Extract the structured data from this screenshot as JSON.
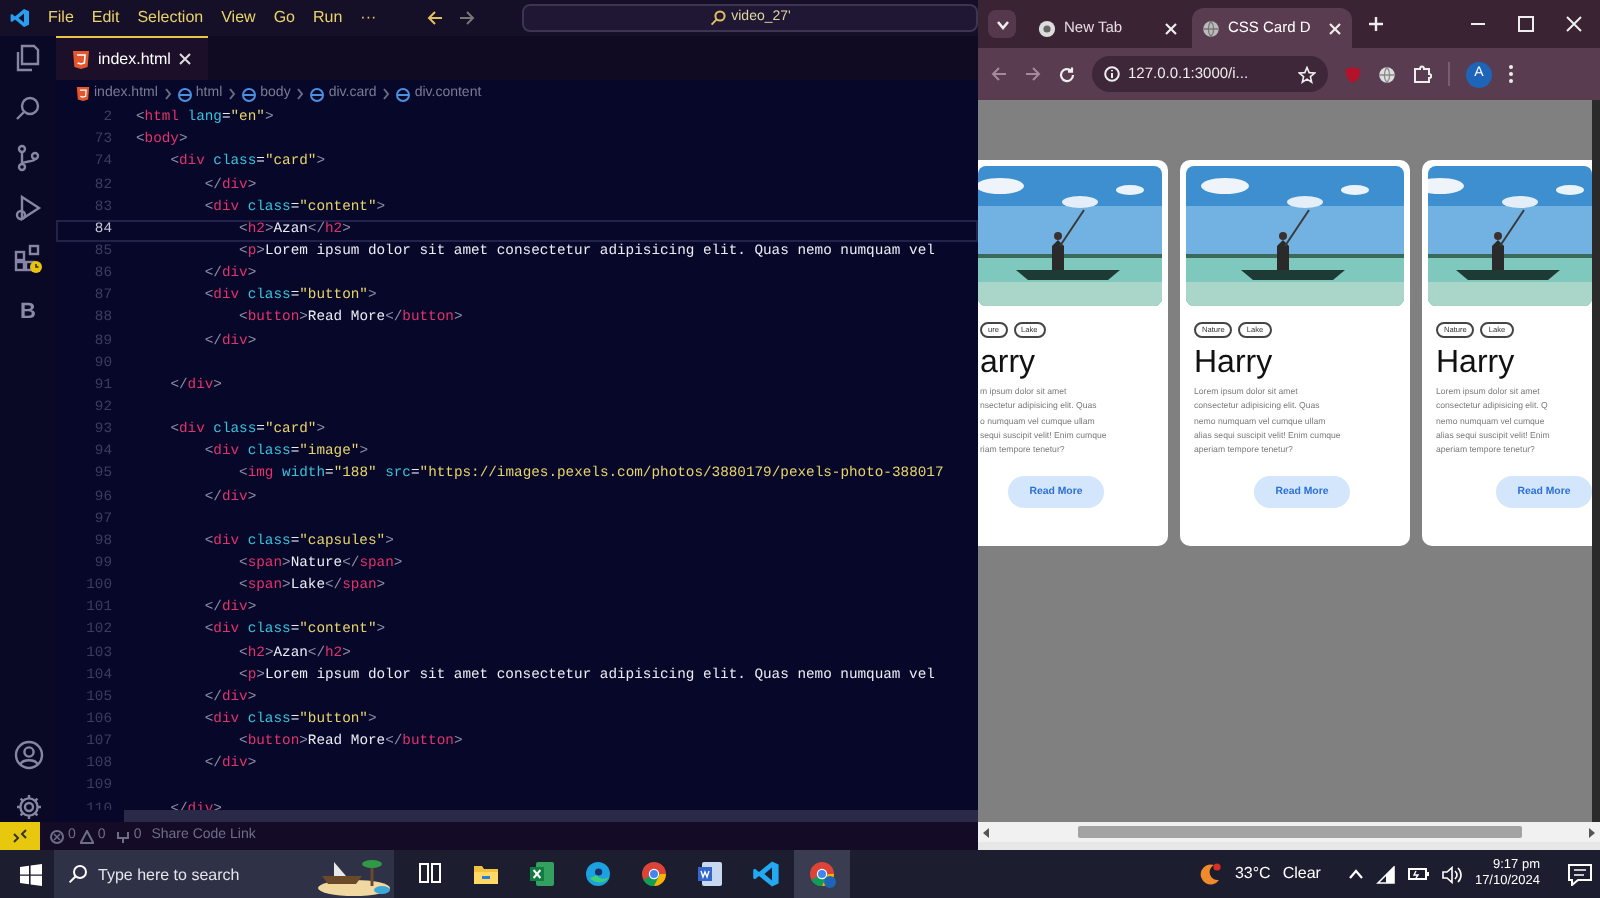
{
  "editor": {
    "menu": [
      "File",
      "Edit",
      "Selection",
      "View",
      "Go",
      "Run",
      "···"
    ],
    "command_center": "video_27'",
    "tab": {
      "label": "index.html"
    },
    "breadcrumb": [
      "index.html",
      "html",
      "body",
      "div.card",
      "div.content"
    ],
    "code_lines": [
      {
        "number": "2",
        "text": "<html lang=\"en\">",
        "current": false
      },
      {
        "number": "73",
        "text": "<body>",
        "current": false
      },
      {
        "number": "74",
        "text": "    <div class=\"card\">",
        "current": false
      },
      {
        "number": "82",
        "text": "        </div>",
        "current": false
      },
      {
        "number": "83",
        "text": "        <div class=\"content\">",
        "current": false
      },
      {
        "number": "84",
        "text": "            <h2>Azan</h2>",
        "current": true
      },
      {
        "number": "85",
        "text": "            <p>Lorem ipsum dolor sit amet consectetur adipisicing elit. Quas nemo numquam vel",
        "current": false
      },
      {
        "number": "86",
        "text": "        </div>",
        "current": false
      },
      {
        "number": "87",
        "text": "        <div class=\"button\">",
        "current": false
      },
      {
        "number": "88",
        "text": "            <button>Read More</button>",
        "current": false
      },
      {
        "number": "89",
        "text": "        </div>",
        "current": false
      },
      {
        "number": "90",
        "current": false
      },
      {
        "number": "91",
        "text": "    </div>",
        "current": false
      },
      {
        "number": "92",
        "current": false
      },
      {
        "number": "93",
        "text": "    <div class=\"card\">",
        "current": false
      },
      {
        "number": "94",
        "text": "        <div class=\"image\">",
        "current": false
      },
      {
        "number": "95",
        "text": "            <img width=\"188\" src=\"https://images.pexels.com/photos/3880179/pexels-photo-388017",
        "current": false
      },
      {
        "number": "96",
        "text": "        </div>",
        "current": false
      },
      {
        "number": "97",
        "current": false
      },
      {
        "number": "98",
        "text": "        <div class=\"capsules\">",
        "current": false
      },
      {
        "number": "99",
        "text": "            <span>Nature</span>",
        "current": false
      },
      {
        "number": "100",
        "text": "            <span>Lake</span>",
        "current": false
      },
      {
        "number": "101",
        "text": "        </div>",
        "current": false
      },
      {
        "number": "102",
        "text": "        <div class=\"content\">",
        "current": false
      },
      {
        "number": "103",
        "text": "            <h2>Azan</h2>",
        "current": false
      },
      {
        "number": "104",
        "text": "            <p>Lorem ipsum dolor sit amet consectetur adipisicing elit. Quas nemo numquam vel",
        "current": false
      },
      {
        "number": "105",
        "text": "        </div>",
        "current": false
      },
      {
        "number": "106",
        "text": "        <div class=\"button\">",
        "current": false
      },
      {
        "number": "107",
        "text": "            <button>Read More</button>",
        "current": false
      },
      {
        "number": "108",
        "text": "        </div>",
        "current": false
      },
      {
        "number": "109",
        "current": false
      },
      {
        "number": "110",
        "text": "    </div>",
        "current": false
      }
    ],
    "activity_letter": "B",
    "status_bar": {
      "errors": "0",
      "warnings": "0",
      "ports": "0",
      "share": "Share Code Link"
    }
  },
  "browser": {
    "tabs": [
      {
        "label": "New Tab",
        "selected": false
      },
      {
        "label": "CSS Card D",
        "selected": true
      }
    ],
    "address": "127.0.0.1:3000/i...",
    "profile": "A",
    "cards": [
      {
        "image": {
          "kind": "picture"
        },
        "tags": [
          "ure",
          "Lake"
        ],
        "title": "arry",
        "text": "m ipsum dolor sit amet\nnsectetur adipisicing elit. Quas\no numquam vel cumque ullam\nsequi suscipit velit! Enim cumque\nriam tempore tenetur?",
        "button": "Read More"
      },
      {
        "image": {
          "kind": "picture"
        },
        "tags": [
          "Nature",
          "Lake"
        ],
        "title": "Harry",
        "text": "Lorem ipsum dolor sit amet\nconsectetur adipisicing elit. Quas\nnemo numquam vel cumque ullam\nalias sequi suscipit velit! Enim cumque\naperiam tempore tenetur?",
        "button": "Read More"
      },
      {
        "image": {
          "kind": "picture"
        },
        "tags": [
          "Nature",
          "Lake"
        ],
        "title": "Harry",
        "text": "Lorem ipsum dolor sit amet\nconsectetur adipisicing elit. Q\nnemo numquam vel cumque\nalias sequi suscipit velit! Enim\naperiam tempore tenetur?",
        "button": "Read More"
      }
    ]
  },
  "taskbar": {
    "search": {
      "placeholder": "Type here to search"
    },
    "temperature": "33°C",
    "weather": "Clear",
    "time": "9:17 pm",
    "date": "17/10/2024"
  }
}
